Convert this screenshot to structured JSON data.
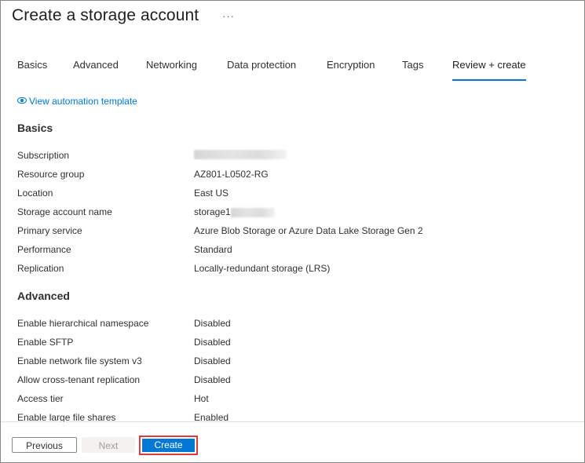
{
  "header": {
    "title": "Create a storage account",
    "more_label": "···"
  },
  "tabs": [
    {
      "label": "Basics"
    },
    {
      "label": "Advanced"
    },
    {
      "label": "Networking"
    },
    {
      "label": "Data protection"
    },
    {
      "label": "Encryption"
    },
    {
      "label": "Tags"
    },
    {
      "label": "Review + create",
      "active": true
    }
  ],
  "automation_link": {
    "label": "View automation template",
    "icon": "eye-icon"
  },
  "basics": {
    "title": "Basics",
    "rows": [
      {
        "label": "Subscription",
        "value": ""
      },
      {
        "label": "Resource group",
        "value": "AZ801-L0502-RG"
      },
      {
        "label": "Location",
        "value": "East US"
      },
      {
        "label": "Storage account name",
        "value": "storage1"
      },
      {
        "label": "Primary service",
        "value": "Azure Blob Storage or Azure Data Lake Storage Gen 2"
      },
      {
        "label": "Performance",
        "value": "Standard"
      },
      {
        "label": "Replication",
        "value": "Locally-redundant storage (LRS)"
      }
    ]
  },
  "advanced": {
    "title": "Advanced",
    "rows": [
      {
        "label": "Enable hierarchical namespace",
        "value": "Disabled"
      },
      {
        "label": "Enable SFTP",
        "value": "Disabled"
      },
      {
        "label": "Enable network file system v3",
        "value": "Disabled"
      },
      {
        "label": "Allow cross-tenant replication",
        "value": "Disabled"
      },
      {
        "label": "Access tier",
        "value": "Hot"
      },
      {
        "label": "Enable large file shares",
        "value": "Enabled"
      }
    ]
  },
  "footer": {
    "previous_label": "Previous",
    "next_label": "Next",
    "create_label": "Create"
  },
  "colors": {
    "accent": "#0078d4",
    "highlight_border": "#e03a3e"
  }
}
